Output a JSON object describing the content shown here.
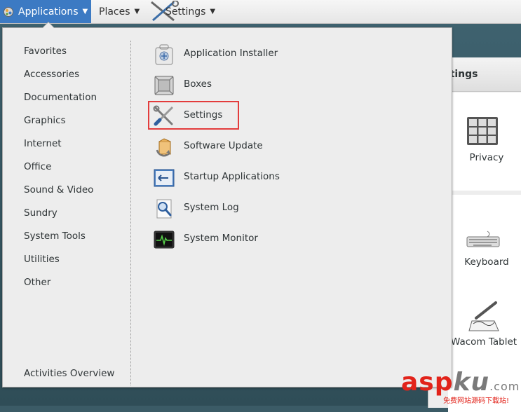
{
  "topbar": {
    "applications_label": "Applications",
    "places_label": "Places",
    "settings_label": "Settings"
  },
  "menu": {
    "categories": [
      "Favorites",
      "Accessories",
      "Documentation",
      "Graphics",
      "Internet",
      "Office",
      "Sound & Video",
      "Sundry",
      "System Tools",
      "Utilities",
      "Other"
    ],
    "activities_overview": "Activities Overview",
    "apps": [
      {
        "label": "Application Installer",
        "icon": "package-installer-icon"
      },
      {
        "label": "Boxes",
        "icon": "boxes-icon"
      },
      {
        "label": "Settings",
        "icon": "settings-tools-icon",
        "highlighted": true
      },
      {
        "label": "Software Update",
        "icon": "software-update-icon"
      },
      {
        "label": "Startup Applications",
        "icon": "startup-applications-icon"
      },
      {
        "label": "System Log",
        "icon": "system-log-icon"
      },
      {
        "label": "System Monitor",
        "icon": "system-monitor-icon"
      }
    ]
  },
  "background_window": {
    "title_fragment": "ttings",
    "items": [
      "Privacy",
      "Keyboard",
      "Wacom Tablet"
    ]
  },
  "watermark": {
    "brand_a": "asp",
    "brand_b": "ku",
    "suffix": ".com",
    "subtitle": "免费网站源码下载站!"
  },
  "colors": {
    "accent": "#3c7ac3",
    "highlight_border": "#e33c3c",
    "watermark_red": "#e2231a"
  }
}
